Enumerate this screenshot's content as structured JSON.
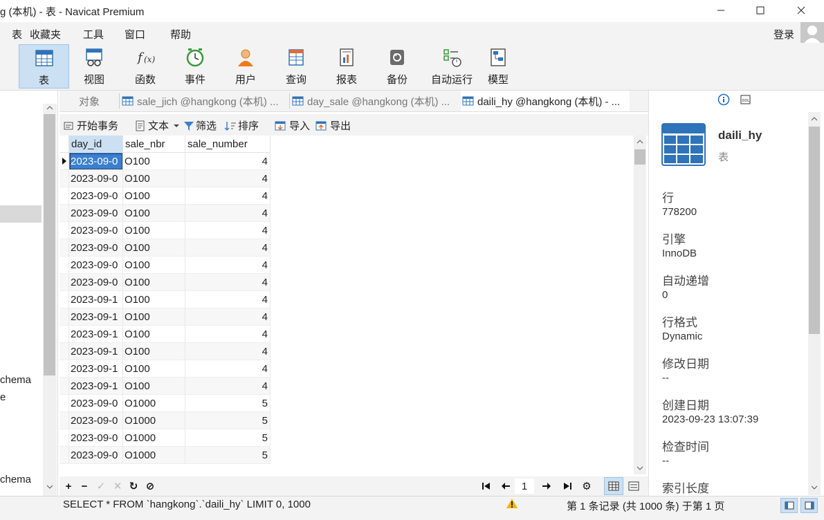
{
  "window": {
    "title": "g (本机) - 表 - Navicat Premium",
    "login_label": "登录"
  },
  "menu": [
    "表",
    "收藏夹",
    "工具",
    "窗口",
    "帮助"
  ],
  "toolbar": [
    {
      "label": "表",
      "icon": "table-icon",
      "active": true
    },
    {
      "label": "视图",
      "icon": "view-icon"
    },
    {
      "label": "函数",
      "icon": "function-icon"
    },
    {
      "label": "事件",
      "icon": "event-clock-icon"
    },
    {
      "label": "用户",
      "icon": "user-icon"
    },
    {
      "label": "查询",
      "icon": "query-icon"
    },
    {
      "label": "报表",
      "icon": "report-icon"
    },
    {
      "label": "备份",
      "icon": "backup-icon"
    },
    {
      "label": "自动运行",
      "icon": "automation-icon"
    },
    {
      "label": "模型",
      "icon": "model-icon"
    }
  ],
  "left_panel": {
    "items": [
      "chema",
      "e",
      "chema"
    ]
  },
  "tabs": [
    {
      "label": "对象"
    },
    {
      "label": "sale_jich @hangkong (本机) ..."
    },
    {
      "label": "day_sale @hangkong (本机) ..."
    },
    {
      "label": "daili_hy @hangkong (本机) - ..."
    }
  ],
  "data_toolbar": {
    "begin_transaction": "开始事务",
    "text": "文本",
    "filter": "筛选",
    "sort": "排序",
    "import": "导入",
    "export": "导出"
  },
  "grid": {
    "columns": [
      "day_id",
      "sale_nbr",
      "sale_number"
    ],
    "rows": [
      [
        "2023-09-0",
        "O100",
        "4"
      ],
      [
        "2023-09-0",
        "O100",
        "4"
      ],
      [
        "2023-09-0",
        "O100",
        "4"
      ],
      [
        "2023-09-0",
        "O100",
        "4"
      ],
      [
        "2023-09-0",
        "O100",
        "4"
      ],
      [
        "2023-09-0",
        "O100",
        "4"
      ],
      [
        "2023-09-0",
        "O100",
        "4"
      ],
      [
        "2023-09-0",
        "O100",
        "4"
      ],
      [
        "2023-09-1",
        "O100",
        "4"
      ],
      [
        "2023-09-1",
        "O100",
        "4"
      ],
      [
        "2023-09-1",
        "O100",
        "4"
      ],
      [
        "2023-09-1",
        "O100",
        "4"
      ],
      [
        "2023-09-1",
        "O100",
        "4"
      ],
      [
        "2023-09-1",
        "O100",
        "4"
      ],
      [
        "2023-09-0",
        "O1000",
        "5"
      ],
      [
        "2023-09-0",
        "O1000",
        "5"
      ],
      [
        "2023-09-0",
        "O1000",
        "5"
      ],
      [
        "2023-09-0",
        "O1000",
        "5"
      ]
    ]
  },
  "nav": {
    "page": "1"
  },
  "status": {
    "sql": "SELECT * FROM `hangkong`.`daili_hy` LIMIT 0, 1000",
    "records": "第 1 条记录 (共 1000 条) 于第 1 页"
  },
  "info_panel": {
    "name": "daili_hy",
    "type": "表",
    "fields": [
      {
        "label": "行",
        "value": "778200"
      },
      {
        "label": "引擎",
        "value": "InnoDB"
      },
      {
        "label": "自动递增",
        "value": "0"
      },
      {
        "label": "行格式",
        "value": "Dynamic"
      },
      {
        "label": "修改日期",
        "value": "--"
      },
      {
        "label": "创建日期",
        "value": "2023-09-23 13:07:39"
      },
      {
        "label": "检查时间",
        "value": "--"
      },
      {
        "label": "索引长度",
        "value": ""
      }
    ]
  },
  "colors": {
    "selection": "#cce0f3",
    "selected_cell": "#3a7fd0",
    "accent": "#1f6fd1"
  }
}
